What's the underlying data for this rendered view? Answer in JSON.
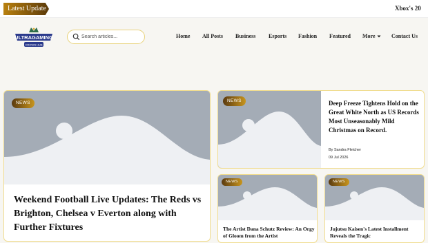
{
  "ticker": {
    "badge_label": "Latest Update",
    "headline": "Xbox's 20"
  },
  "logo": {
    "name": "ULTRAGAMING",
    "tagline": "CROWN HUB"
  },
  "search": {
    "placeholder": "Search articles..."
  },
  "nav": {
    "items": [
      "Home",
      "All Posts",
      "Business",
      "Esports",
      "Fashion",
      "Featured",
      "More",
      "Contact Us"
    ]
  },
  "articles": {
    "main": {
      "badge": "NEWS",
      "title": "Weekend Football Live Updates: The Reds vs Brighton, Chelsea v Everton along with Further Fixtures"
    },
    "right_top": {
      "badge": "NEWS",
      "title": "Deep Freeze Tightens Hold on the Great White North as US Records Most Unseasonably Mild Christmas on Record.",
      "author": "By Sandra Fletcher",
      "date": "09 Jul 2026"
    },
    "bottom_left": {
      "badge": "NEWS",
      "title": "The Artist Dana Schutz Review: An Orgy of Gloom from the Artist"
    },
    "bottom_right": {
      "badge": "NEWS",
      "title": "Jujutsu Kaisen's Latest Installment Reveals the Tragic"
    }
  },
  "colors": {
    "accent": "#c8951d",
    "border": "#f0dc8e",
    "placeholder": "#a4acb6"
  }
}
